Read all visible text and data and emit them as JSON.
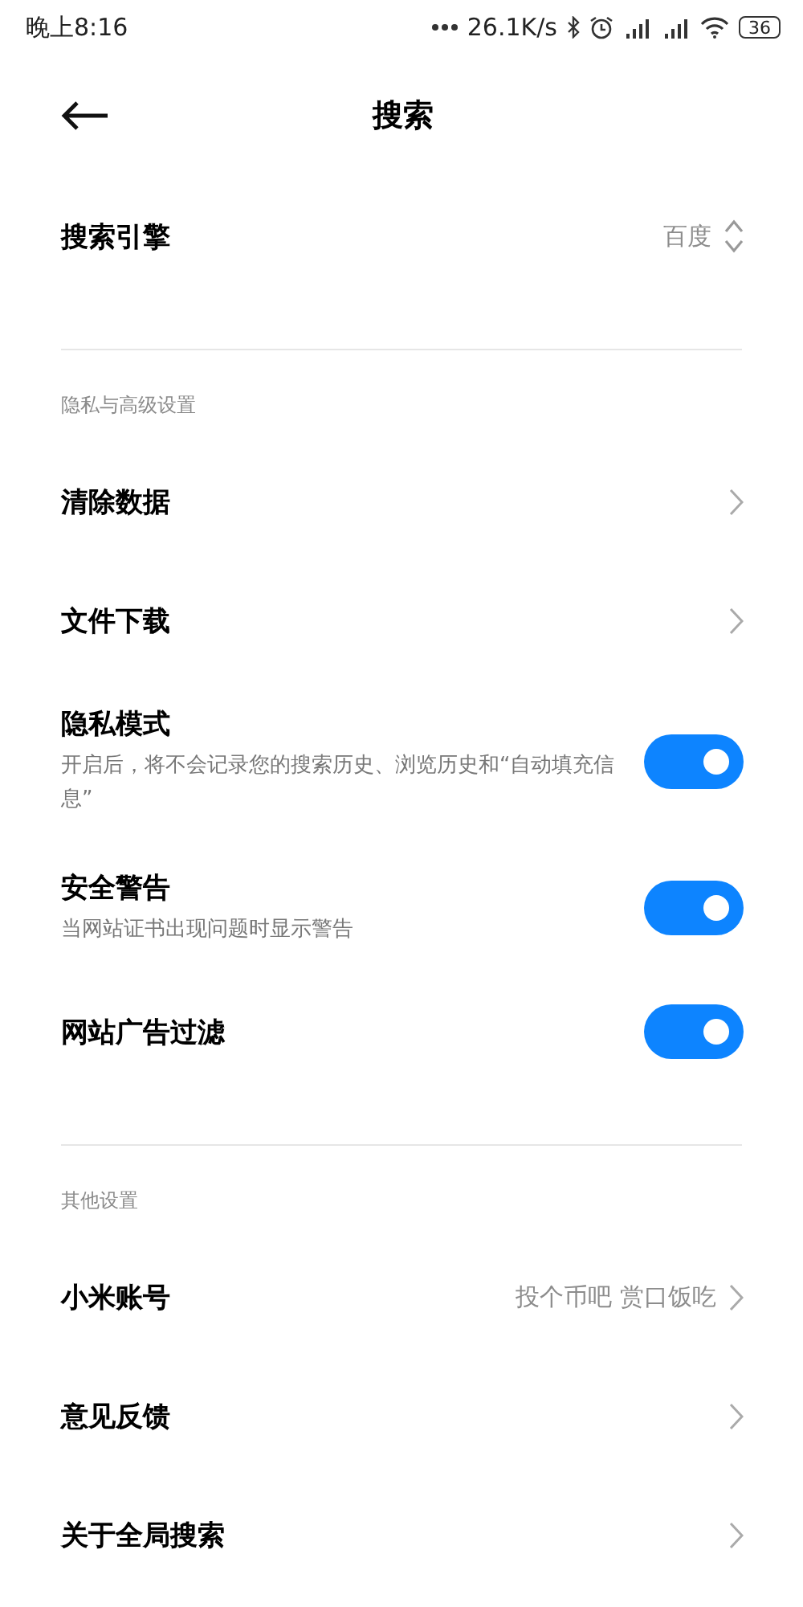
{
  "status_bar": {
    "time": "晚上8:16",
    "speed": "26.1K/s",
    "battery": "36"
  },
  "header": {
    "title": "搜索"
  },
  "sections": [
    {
      "rows": [
        {
          "kind": "select",
          "title": "搜索引擎",
          "value": "百度"
        }
      ]
    },
    {
      "label": "隐私与高级设置",
      "rows": [
        {
          "kind": "link",
          "title": "清除数据"
        },
        {
          "kind": "link",
          "title": "文件下载"
        },
        {
          "kind": "toggle",
          "title": "隐私模式",
          "description": "开启后，将不会记录您的搜索历史、浏览历史和“自动填充信息”",
          "on": true
        },
        {
          "kind": "toggle",
          "title": "安全警告",
          "description": "当网站证书出现问题时显示警告",
          "on": true
        },
        {
          "kind": "toggle",
          "title": "网站广告过滤",
          "on": true
        }
      ]
    },
    {
      "label": "其他设置",
      "rows": [
        {
          "kind": "link",
          "title": "小米账号",
          "value": "投个币吧 赏口饭吃"
        },
        {
          "kind": "link",
          "title": "意见反馈"
        },
        {
          "kind": "link",
          "title": "关于全局搜索"
        }
      ]
    }
  ]
}
